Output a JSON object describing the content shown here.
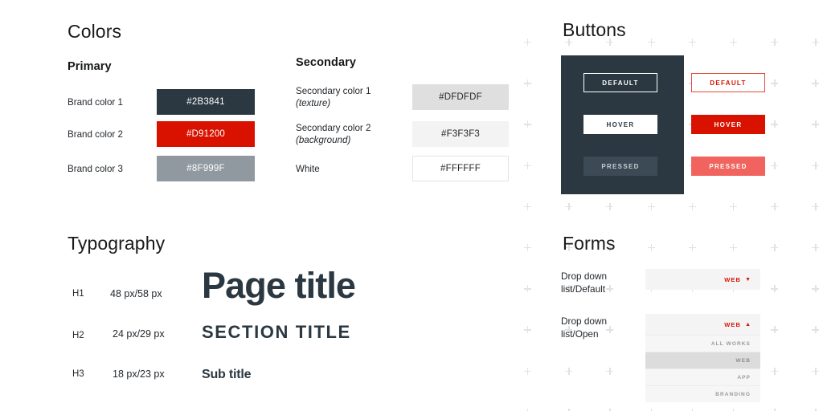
{
  "page": {
    "background": "#ffffff",
    "accent_dark": "#2B3841",
    "accent_red": "#D91200",
    "accent_gray": "#8F999F"
  },
  "colors_section": {
    "title": "Colors",
    "primary": {
      "heading": "Primary",
      "rows": [
        {
          "label": "Brand color 1",
          "value": "#2B3841",
          "hex": "#2B3841",
          "text_color": "#FFFFFF"
        },
        {
          "label": "Brand color 2",
          "value": "#D91200",
          "hex": "#D91200",
          "text_color": "#FFFFFF"
        },
        {
          "label": "Brand color 3",
          "value": "#8F999F",
          "hex": "#8F999F",
          "text_color": "#FFFFFF"
        }
      ]
    },
    "secondary": {
      "heading": "Secondary",
      "rows": [
        {
          "label": "Secondary color 1",
          "sublabel": "(texture)",
          "value": "#DFDFDF",
          "hex": "#DFDFDF",
          "text_color": "#1F2326"
        },
        {
          "label": "Secondary color 2",
          "sublabel": "(background)",
          "value": "#F3F3F3",
          "hex": "#F3F3F3",
          "text_color": "#1F2326"
        },
        {
          "label": "White",
          "sublabel": "",
          "value": "#FFFFFF",
          "hex": "#FFFFFF",
          "text_color": "#1F2326"
        }
      ]
    }
  },
  "typography_section": {
    "title": "Typography",
    "rows": [
      {
        "tag": "H1",
        "metric": "48 px/58 px",
        "sample": "Page title"
      },
      {
        "tag": "H2",
        "metric": "24 px/29 px",
        "sample": "SECTION TITLE"
      },
      {
        "tag": "H3",
        "metric": "18 px/23 px",
        "sample": "Sub title"
      }
    ]
  },
  "buttons_section": {
    "title": "Buttons",
    "dark_panel": {
      "background": "#2B3841",
      "buttons": [
        {
          "label": "DEFAULT",
          "state": "default"
        },
        {
          "label": "HOVER",
          "state": "hover"
        },
        {
          "label": "PRESSED",
          "state": "pressed"
        }
      ]
    },
    "light_panel": {
      "buttons": [
        {
          "label": "DEFAULT",
          "state": "default"
        },
        {
          "label": "HOVER",
          "state": "hover"
        },
        {
          "label": "PRESSED",
          "state": "pressed"
        }
      ]
    }
  },
  "forms_section": {
    "title": "Forms",
    "dropdown_default": {
      "label": "Drop down\nlist/Default",
      "value": "WEB",
      "caret": "▼"
    },
    "dropdown_open": {
      "label": "Drop down\nlist/Open",
      "value": "WEB",
      "caret": "▲",
      "options": [
        {
          "label": "ALL WORKS",
          "selected": false
        },
        {
          "label": "WEB",
          "selected": true
        },
        {
          "label": "APP",
          "selected": false
        },
        {
          "label": "BRANDING",
          "selected": false
        }
      ]
    }
  }
}
